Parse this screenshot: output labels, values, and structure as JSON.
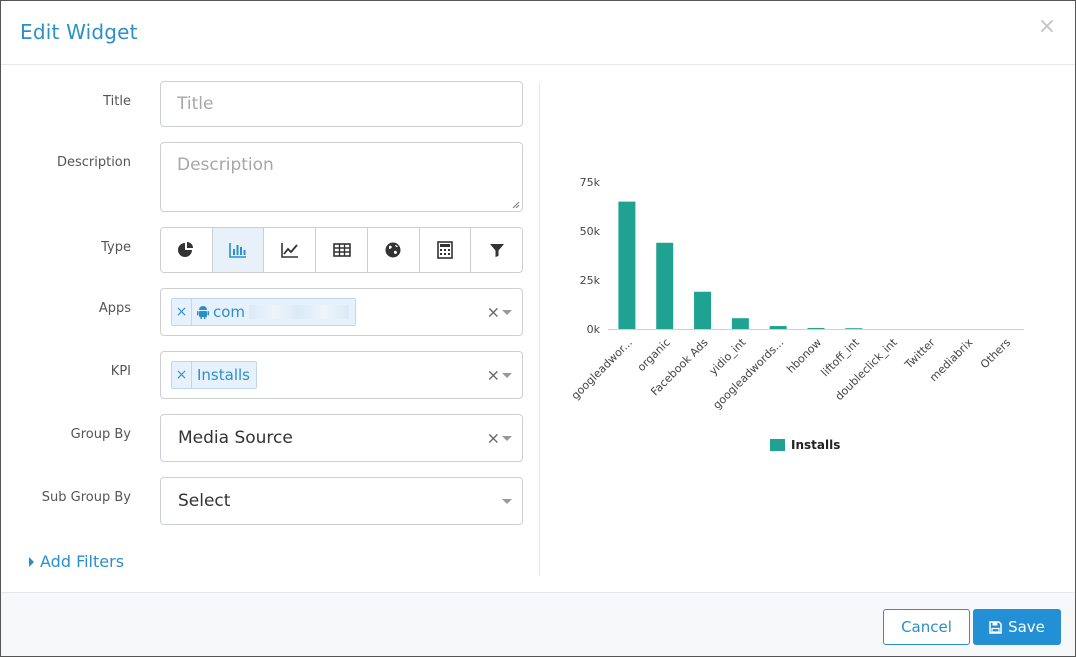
{
  "header": {
    "title": "Edit Widget",
    "close_glyph": "×"
  },
  "form": {
    "title": {
      "label": "Title",
      "placeholder": "Title"
    },
    "description": {
      "label": "Description",
      "placeholder": "Description"
    },
    "type": {
      "label": "Type",
      "options": [
        {
          "icon": "pie-chart-icon"
        },
        {
          "icon": "bar-chart-icon",
          "active": true
        },
        {
          "icon": "line-chart-icon"
        },
        {
          "icon": "table-icon"
        },
        {
          "icon": "globe-icon"
        },
        {
          "icon": "calculator-icon"
        },
        {
          "icon": "funnel-icon"
        }
      ]
    },
    "apps": {
      "label": "Apps",
      "tag_remove": "×",
      "tag_icon": "android-icon",
      "tag_text": "com",
      "clear": "×"
    },
    "kpi": {
      "label": "KPI",
      "tag_remove": "×",
      "tag_text": "Installs",
      "clear": "×"
    },
    "group_by": {
      "label": "Group By",
      "value": "Media Source",
      "clear": "×"
    },
    "sub_group_by": {
      "label": "Sub Group By",
      "placeholder": "Select"
    }
  },
  "add_filters": "Add Filters",
  "chart_data": {
    "type": "bar",
    "categories": [
      "googleadwor...",
      "organic",
      "Facebook Ads",
      "yidio_int",
      "googleadwords...",
      "hbonow",
      "liftoff_int",
      "doubleclick_int",
      "Twitter",
      "mediabrix",
      "Others"
    ],
    "series": [
      {
        "name": "Installs",
        "values": [
          65000,
          44000,
          19000,
          5500,
          1500,
          500,
          400,
          0,
          0,
          0,
          0
        ]
      }
    ],
    "yticks": [
      "0k",
      "25k",
      "50k",
      "75k"
    ],
    "ylim": [
      0,
      75000
    ],
    "color": "#1fa292",
    "legend": "bottom-center",
    "grid": false
  },
  "footer": {
    "cancel_label": "Cancel",
    "save_label": "Save"
  },
  "colors": {
    "accent": "#2b8fcc",
    "bar": "#1fa292"
  }
}
